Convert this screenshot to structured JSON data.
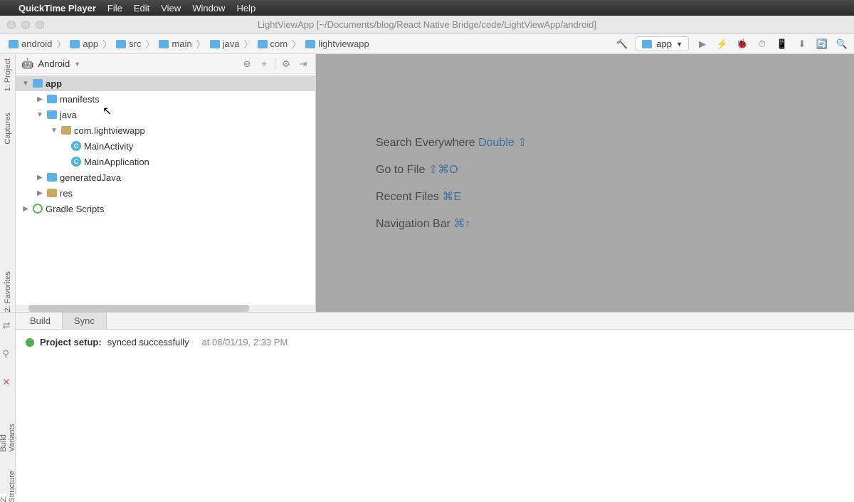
{
  "macmenu": {
    "app": "QuickTime Player",
    "items": [
      "File",
      "Edit",
      "View",
      "Window",
      "Help"
    ]
  },
  "window": {
    "title": "LightViewApp [~/Documents/blog/React Native Bridge/code/LightViewApp/android]"
  },
  "crumbs": [
    "android",
    "app",
    "src",
    "main",
    "java",
    "com",
    "lightviewapp"
  ],
  "run_config": "app",
  "project_view": {
    "label": "Android"
  },
  "left_tabs": {
    "project": "1: Project",
    "captures": "Captures",
    "favorites": "2: Favorites"
  },
  "tree": {
    "root": "app",
    "manifests": "manifests",
    "java": "java",
    "pkg": "com.lightviewapp",
    "cls1": "MainActivity",
    "cls2": "MainApplication",
    "gen": "generatedJava",
    "res": "res",
    "gradle": "Gradle Scripts"
  },
  "hints": {
    "search": {
      "label": "Search Everywhere",
      "kb": "Double ⇧"
    },
    "goto": {
      "label": "Go to File",
      "kb": "⇧⌘O"
    },
    "recent": {
      "label": "Recent Files",
      "kb": "⌘E"
    },
    "nav": {
      "label": "Navigation Bar",
      "kb": "⌘↑"
    }
  },
  "btabs": {
    "build": "Build",
    "sync": "Sync"
  },
  "sync": {
    "label": "Project setup:",
    "msg": "synced successfully",
    "ts": "at 08/01/19, 2:33 PM"
  },
  "bl_tabs": {
    "variants": "Build Variants",
    "structure": "2: Structure"
  }
}
